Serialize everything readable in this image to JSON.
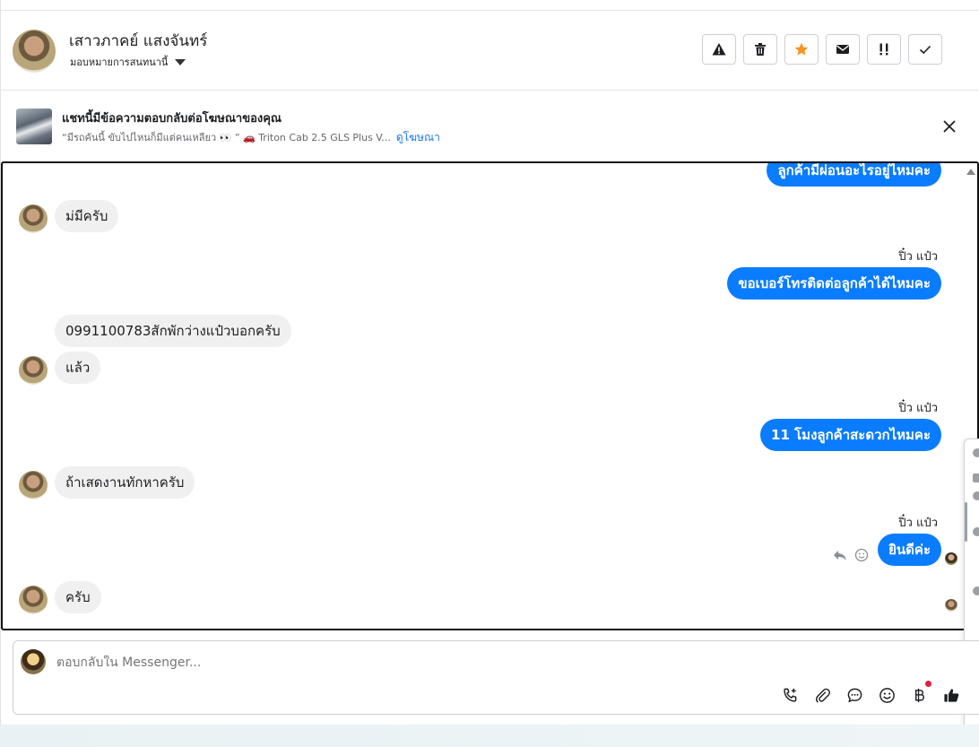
{
  "header": {
    "contact_name": "เสาวภาคย์ แสงจันทร์",
    "assign_label": "มอบหมายการสนทนานี้",
    "actions": [
      "warning-icon",
      "trash-icon",
      "star-icon",
      "envelope-icon",
      "important-icon",
      "check-icon"
    ]
  },
  "banner": {
    "title": "แชทนี้มีข้อความตอบกลับต่อโฆษณาของคุณ",
    "subtitle": "“มีรถคันนี้ ขับไปไหนก็มีแต่คนเหลียว 👀 ” 🚗 Triton Cab 2.5 GLS Plus V...",
    "link": "ดูโฆษณา"
  },
  "messages": {
    "m1": "ลูกค้ามีผ่อนอะไรอยู่ไหมคะ",
    "m2": "ม่มีครับ",
    "sender1": "ปิ๋ว แป๋ว",
    "m3": "ขอเบอร์โทรติดต่อลูกค้าได้ไหมคะ",
    "m4": "0991100783สักพักว่างแป๋วบอกครับ",
    "m5": "แล้ว",
    "sender2": "ปิ๋ว แป๋ว",
    "m6": "11 โมงลูกค้าสะดวกไหมคะ",
    "m7": "ถ้าเสดงานทักหาครับ",
    "sender3": "ปิ๋ว แป๋ว",
    "m8": "ยินดีค่ะ",
    "m9": "ครับ"
  },
  "composer": {
    "placeholder": "ตอบกลับใน Messenger...",
    "tools": [
      "call-plus-icon",
      "attach-icon",
      "chat-bubble-icon",
      "emoji-icon",
      "baht-icon",
      "like-icon"
    ]
  },
  "colors": {
    "outgoing_bubble": "#0a7cff",
    "incoming_bubble": "#f0f0f0",
    "star": "#f7931e",
    "link": "#1877f2"
  }
}
